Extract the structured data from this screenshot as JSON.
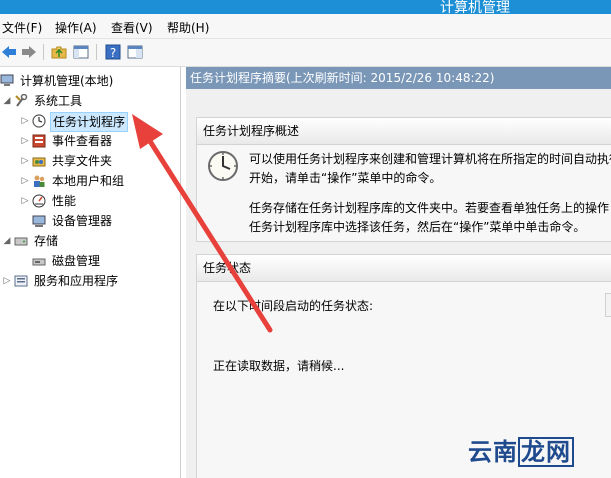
{
  "window": {
    "title": "计算机管理"
  },
  "menu": {
    "file": "文件(F)",
    "action": "操作(A)",
    "view": "查看(V)",
    "help": "帮助(H)"
  },
  "tree": {
    "root": "计算机管理(本地)",
    "system_tools": "系统工具",
    "task_scheduler": "任务计划程序",
    "event_viewer": "事件查看器",
    "shared_folders": "共享文件夹",
    "local_users": "本地用户和组",
    "performance": "性能",
    "device_manager": "设备管理器",
    "storage": "存储",
    "disk_management": "磁盘管理",
    "services_apps": "服务和应用程序"
  },
  "main": {
    "header": "任务计划程序摘要(上次刷新时间: 2015/2/26 10:48:22)",
    "overview": {
      "title": "任务计划程序概述",
      "line1": "可以使用任务计划程序来创建和管理计算机将在所指定的时间自动执行",
      "line2": "开始，请单击“操作”菜单中的命令。",
      "line3": "任务存储在任务计划程序库的文件夹中。若要查看单独任务上的操作",
      "line4": "任务计划程序库中选择该任务，然后在“操作”菜单中单击命令。"
    },
    "status": {
      "title": "任务状态",
      "line1": "在以下时间段启动的任务状态:",
      "loading": "正在读取数据，请稍候..."
    }
  },
  "watermark": {
    "text_part": "云南",
    "boxed": "龙网"
  },
  "colors": {
    "titlebar": "#1c8fd6",
    "pane_header": "#7a97b7",
    "annotation_arrow": "#e8403a"
  }
}
